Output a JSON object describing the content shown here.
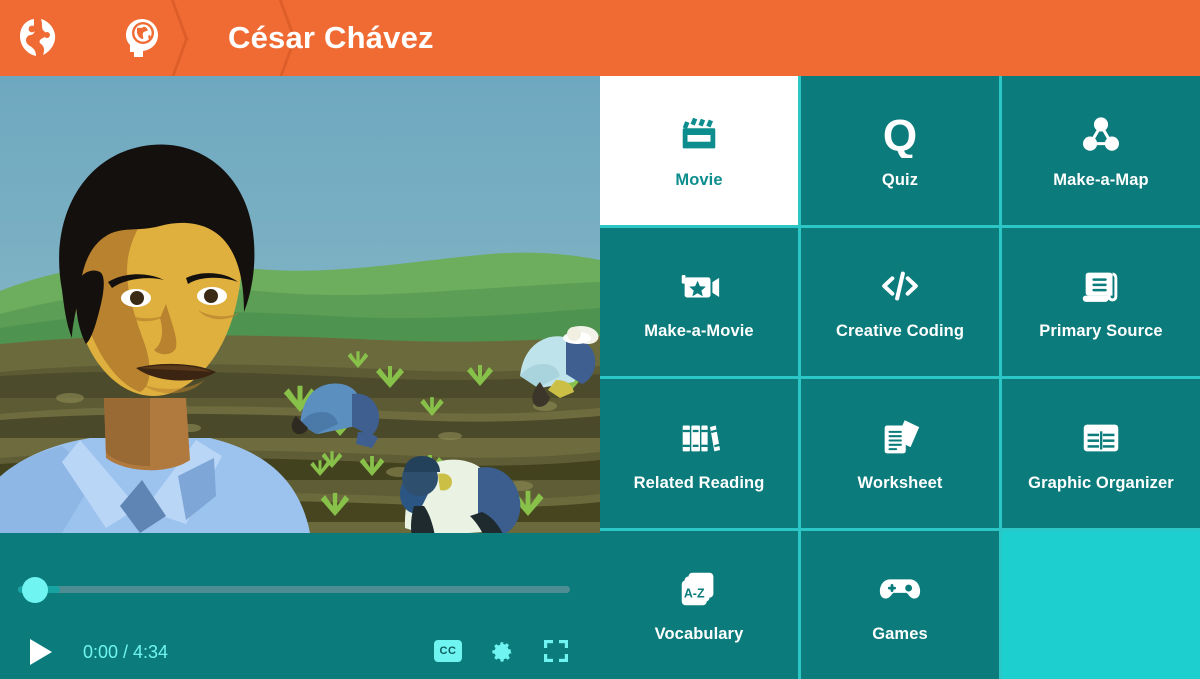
{
  "header": {
    "title": "César Chávez",
    "brand_icon": "world-globe-icon",
    "subject_icon": "social-studies-head-globe-icon",
    "background_color": "#ef6b33"
  },
  "video": {
    "alt": "Illustration of César Chávez in a light blue shirt in front of farm workers picking crops in a field",
    "controls": {
      "play_label": "Play",
      "current_time": "0:00",
      "duration": "4:34",
      "time_display": "0:00 / 4:34",
      "progress_percent": 0,
      "cc_label": "CC",
      "settings_icon": "gear-icon",
      "fullscreen_icon": "fullscreen-icon",
      "accent_color": "#6ff4f2"
    }
  },
  "grid": {
    "active_index": 0,
    "tile_color": "#0b7b7b",
    "active_tile_color": "#ffffff",
    "divider_color": "#2bc7c7",
    "empty_tile_color": "#1ecfcf",
    "tiles": [
      {
        "label": "Movie",
        "icon": "clapperboard-icon",
        "active": true
      },
      {
        "label": "Quiz",
        "icon": "quiz-q-icon",
        "active": false
      },
      {
        "label": "Make-a-Map",
        "icon": "concept-map-icon",
        "active": false
      },
      {
        "label": "Make-a-Movie",
        "icon": "video-camera-star-icon",
        "active": false
      },
      {
        "label": "Creative Coding",
        "icon": "code-brackets-icon",
        "active": false
      },
      {
        "label": "Primary Source",
        "icon": "scroll-document-icon",
        "active": false
      },
      {
        "label": "Related Reading",
        "icon": "books-icon",
        "active": false
      },
      {
        "label": "Worksheet",
        "icon": "papers-icon",
        "active": false
      },
      {
        "label": "Graphic Organizer",
        "icon": "table-grid-icon",
        "active": false
      },
      {
        "label": "Vocabulary",
        "icon": "az-cards-icon",
        "active": false
      },
      {
        "label": "Games",
        "icon": "gamepad-icon",
        "active": false
      },
      {
        "label": "",
        "icon": "",
        "active": false,
        "empty": true
      }
    ]
  }
}
